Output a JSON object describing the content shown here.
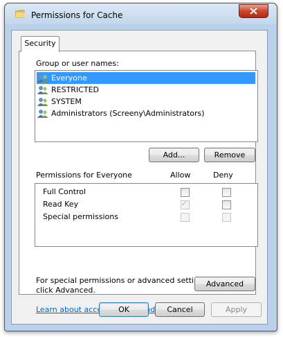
{
  "window": {
    "title": "Permissions for Cache"
  },
  "tabs": [
    {
      "label": "Security"
    }
  ],
  "groups": {
    "label": "Group or user names:",
    "items": [
      {
        "name": "Everyone",
        "selected": true
      },
      {
        "name": "RESTRICTED",
        "selected": false
      },
      {
        "name": "SYSTEM",
        "selected": false
      },
      {
        "name": "Administrators (Screeny\\Administrators)",
        "selected": false
      }
    ]
  },
  "buttons": {
    "add": "Add...",
    "remove": "Remove",
    "advanced": "Advanced",
    "ok": "OK",
    "cancel": "Cancel",
    "apply": "Apply"
  },
  "permissions": {
    "header": "Permissions for Everyone",
    "allow_label": "Allow",
    "deny_label": "Deny",
    "rows": [
      {
        "name": "Full Control",
        "allow": false,
        "deny": false,
        "allow_enabled": true,
        "deny_enabled": true
      },
      {
        "name": "Read Key",
        "allow": true,
        "deny": false,
        "allow_enabled": false,
        "deny_enabled": true
      },
      {
        "name": "Special permissions",
        "allow": false,
        "deny": false,
        "allow_enabled": false,
        "deny_enabled": false
      }
    ]
  },
  "advanced_note": {
    "line1": "For special permissions or advanced settings,",
    "line2": "click Advanced."
  },
  "link": "Learn about access control and permissions",
  "colors": {
    "selection": "#3399ff",
    "link": "#0066cc",
    "frame": "#b9d1ea"
  }
}
